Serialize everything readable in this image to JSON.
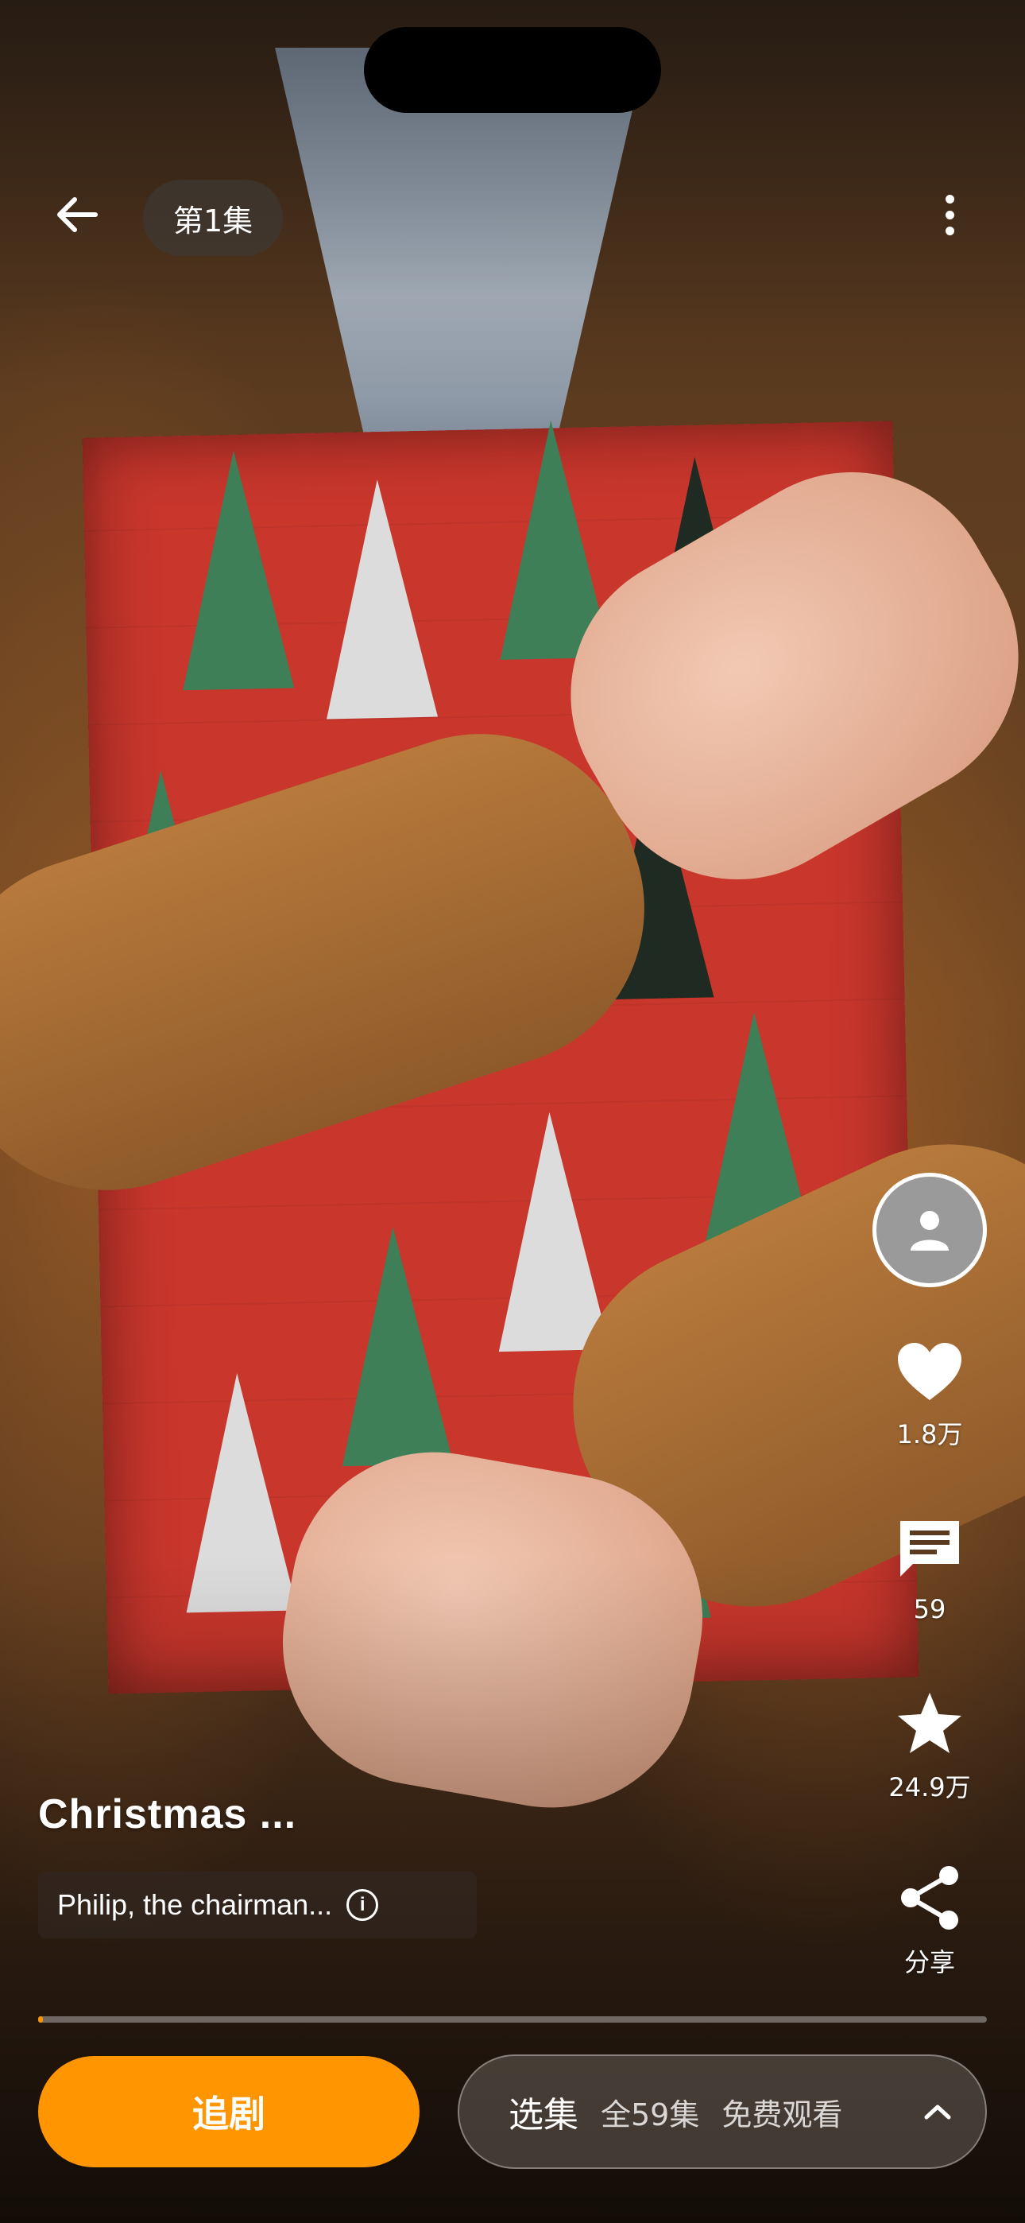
{
  "header": {
    "episode_label": "第1集"
  },
  "actions": {
    "likes": "1.8万",
    "comments": "59",
    "favorites": "24.9万",
    "share_label": "分享"
  },
  "drama": {
    "title": "Christmas ...",
    "description": "Philip, the chairman..."
  },
  "playback": {
    "progress": 0.003
  },
  "bottom_bar": {
    "follow_label": "追剧",
    "episodes_label": "选集",
    "total_episodes": "全59集",
    "free_label": "免费观看"
  },
  "colors": {
    "accent": "#ff9500"
  }
}
